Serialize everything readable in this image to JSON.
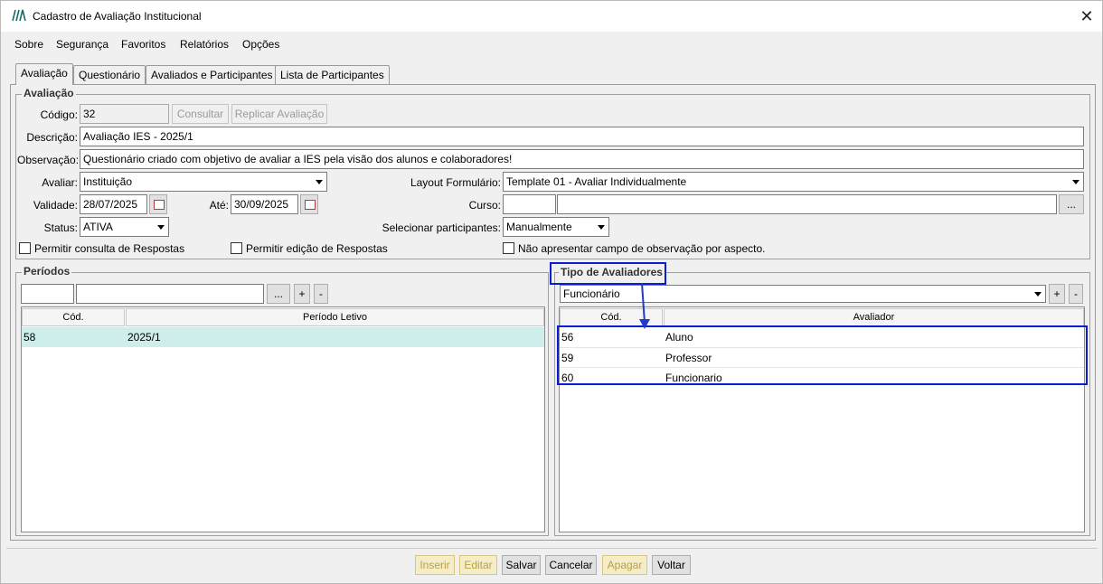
{
  "window": {
    "title": "Cadastro de Avaliação Institucional",
    "close_label": "✕"
  },
  "menu": [
    {
      "label": "Sobre"
    },
    {
      "label": "Segurança"
    },
    {
      "label": "Favoritos"
    },
    {
      "label": "Relatórios"
    },
    {
      "label": "Opções"
    }
  ],
  "tabs": [
    {
      "label": "Avaliação"
    },
    {
      "label": "Questionário"
    },
    {
      "label": "Avaliados e Participantes"
    },
    {
      "label": "Lista de Participantes"
    }
  ],
  "avaliacao": {
    "group_title": "Avaliação",
    "codigo_label": "Código:",
    "codigo_value": "32",
    "consultar_label": "Consultar",
    "replicar_label": "Replicar Avaliação",
    "descricao_label": "Descrição:",
    "descricao_value": "Avaliação IES - 2025/1",
    "observacao_label": "Observação:",
    "observacao_value": "Questionário criado com objetivo de avaliar a IES pela visão dos alunos e colaboradores!",
    "avaliar_label": "Avaliar:",
    "avaliar_value": "Instituição",
    "layout_label": "Layout Formulário:",
    "layout_value": "Template 01 - Avaliar Individualmente",
    "validade_label": "Validade:",
    "validade_value": "28/07/2025",
    "ate_label": "Até:",
    "ate_value": "30/09/2025",
    "curso_label": "Curso:",
    "curso_code": "",
    "curso_name": "",
    "curso_btn": "...",
    "status_label": "Status:",
    "status_value": "ATIVA",
    "selecionar_label": "Selecionar participantes:",
    "selecionar_value": "Manualmente",
    "chk_consulta": "Permitir consulta de Respostas",
    "chk_edicao": "Permitir edição de Respostas",
    "chk_observacao": "Não apresentar campo de observação por aspecto."
  },
  "periodos": {
    "group_title": "Períodos",
    "code_value": "",
    "name_value": "",
    "btn_browse": "...",
    "btn_add": "+",
    "btn_remove": "-",
    "columns": [
      "Cód.",
      "Período Letivo"
    ],
    "rows": [
      {
        "cod": "58",
        "periodo": "2025/1"
      }
    ]
  },
  "avaliadores": {
    "group_title": "Tipo de Avaliadores",
    "combo_value": "Funcionário",
    "btn_add": "+",
    "btn_remove": "-",
    "columns": [
      "Cód.",
      "Avaliador"
    ],
    "rows": [
      {
        "cod": "56",
        "avaliador": "Aluno"
      },
      {
        "cod": "59",
        "avaliador": "Professor"
      },
      {
        "cod": "60",
        "avaliador": "Funcionario"
      }
    ]
  },
  "footer_buttons": {
    "inserir": "Inserir",
    "editar": "Editar",
    "salvar": "Salvar",
    "cancelar": "Cancelar",
    "apagar": "Apagar",
    "voltar": "Voltar"
  },
  "colors": {
    "highlight": "#0a1ed0",
    "selected_row": "#cdeeea",
    "accent_arrow": "#1e3cc8"
  }
}
